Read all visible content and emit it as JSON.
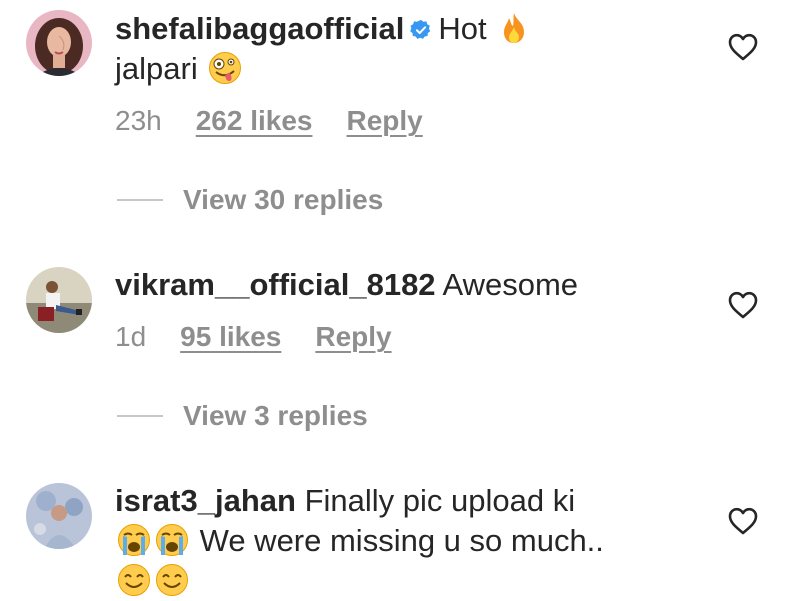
{
  "comments": [
    {
      "username": "shefalibaggaofficial",
      "verified": true,
      "text_line1": "Hot",
      "text_line2": "jalpari",
      "time": "23h",
      "likes": "262 likes",
      "reply": "Reply",
      "view_replies": "View 30 replies",
      "emojis": [
        "fire-emoji",
        "zany-face-emoji"
      ]
    },
    {
      "username": "vikram__official_8182",
      "text": "Awesome",
      "time": "1d",
      "likes": "95 likes",
      "reply": "Reply",
      "view_replies": "View 3 replies"
    },
    {
      "username": "israt3_jahan",
      "text_line1": "Finally pic upload  ki",
      "text_line2": "We were missing u so much..",
      "emojis": [
        "loudly-crying-face-emoji",
        "loudly-crying-face-emoji",
        "smiling-face-emoji",
        "smiling-face-emoji"
      ]
    }
  ],
  "colors": {
    "text": "#262626",
    "secondary": "#8e8e8e",
    "verified": "#3897f0"
  }
}
